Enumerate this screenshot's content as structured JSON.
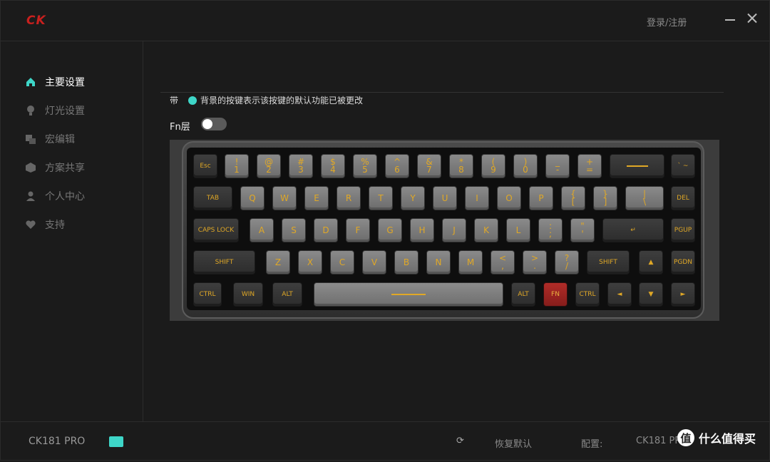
{
  "app": {
    "logo": "CK",
    "login": "登录/注册"
  },
  "sidebar": {
    "items": [
      {
        "label": "主要设置",
        "icon": "home-icon",
        "active": true
      },
      {
        "label": "灯光设置",
        "icon": "bulb-icon",
        "active": false
      },
      {
        "label": "宏编辑",
        "icon": "macro-icon",
        "active": false
      },
      {
        "label": "方案共享",
        "icon": "cube-icon",
        "active": false
      },
      {
        "label": "个人中心",
        "icon": "user-icon",
        "active": false
      },
      {
        "label": "支持",
        "icon": "heart-icon",
        "active": false
      }
    ]
  },
  "main": {
    "legend_prefix": "带",
    "legend_text": "背景的按键表示该按键的默认功能已被更改",
    "legend_color": "#3ed6c8",
    "fn_layer_label": "Fn层",
    "fn_layer_on": false
  },
  "keyboard": {
    "rows": [
      [
        {
          "t": "Esc"
        },
        {
          "t": "!",
          "b": "1"
        },
        {
          "t": "@",
          "b": "2"
        },
        {
          "t": "#",
          "b": "3"
        },
        {
          "t": "$",
          "b": "4"
        },
        {
          "t": "%",
          "b": "5"
        },
        {
          "t": "^",
          "b": "6"
        },
        {
          "t": "&",
          "b": "7"
        },
        {
          "t": "*",
          "b": "8"
        },
        {
          "t": "(",
          "b": "9"
        },
        {
          "t": ")",
          "b": "0"
        },
        {
          "t": "_",
          "b": "-"
        },
        {
          "t": "+",
          "b": "="
        },
        {
          "t": ""
        },
        {
          "t": "` ~"
        }
      ],
      [
        {
          "t": "TAB"
        },
        {
          "t": "Q"
        },
        {
          "t": "W"
        },
        {
          "t": "E"
        },
        {
          "t": "R"
        },
        {
          "t": "T"
        },
        {
          "t": "Y"
        },
        {
          "t": "U"
        },
        {
          "t": "I"
        },
        {
          "t": "O"
        },
        {
          "t": "P"
        },
        {
          "t": "{",
          "b": "["
        },
        {
          "t": "}",
          "b": "]"
        },
        {
          "t": "|",
          "b": "\\"
        },
        {
          "t": "DEL"
        }
      ],
      [
        {
          "t": "CAPS LOCK"
        },
        {
          "t": "A"
        },
        {
          "t": "S"
        },
        {
          "t": "D"
        },
        {
          "t": "F"
        },
        {
          "t": "G"
        },
        {
          "t": "H"
        },
        {
          "t": "J"
        },
        {
          "t": "K"
        },
        {
          "t": "L"
        },
        {
          "t": ":",
          "b": ";"
        },
        {
          "t": "\"",
          "b": "'"
        },
        {
          "t": "↵"
        },
        {
          "t": "PGUP"
        }
      ],
      [
        {
          "t": "SHIFT"
        },
        {
          "t": "Z"
        },
        {
          "t": "X"
        },
        {
          "t": "C"
        },
        {
          "t": "V"
        },
        {
          "t": "B"
        },
        {
          "t": "N"
        },
        {
          "t": "M"
        },
        {
          "t": "<",
          "b": ","
        },
        {
          "t": ">",
          "b": "."
        },
        {
          "t": "?",
          "b": "/"
        },
        {
          "t": "SHIFT"
        },
        {
          "t": "▲"
        },
        {
          "t": "PGDN"
        }
      ],
      [
        {
          "t": "CTRL"
        },
        {
          "t": "WIN"
        },
        {
          "t": "ALT"
        },
        {
          "t": ""
        },
        {
          "t": "ALT"
        },
        {
          "t": "FN"
        },
        {
          "t": "CTRL"
        },
        {
          "t": "◄"
        },
        {
          "t": "▼"
        },
        {
          "t": "►"
        }
      ]
    ]
  },
  "status": {
    "device": "CK181 PRO",
    "restore": "恢复默认",
    "config_label": "配置:",
    "config_value": "CK181 PRO",
    "watermark": "什么值得买",
    "watermark_badge": "值"
  }
}
